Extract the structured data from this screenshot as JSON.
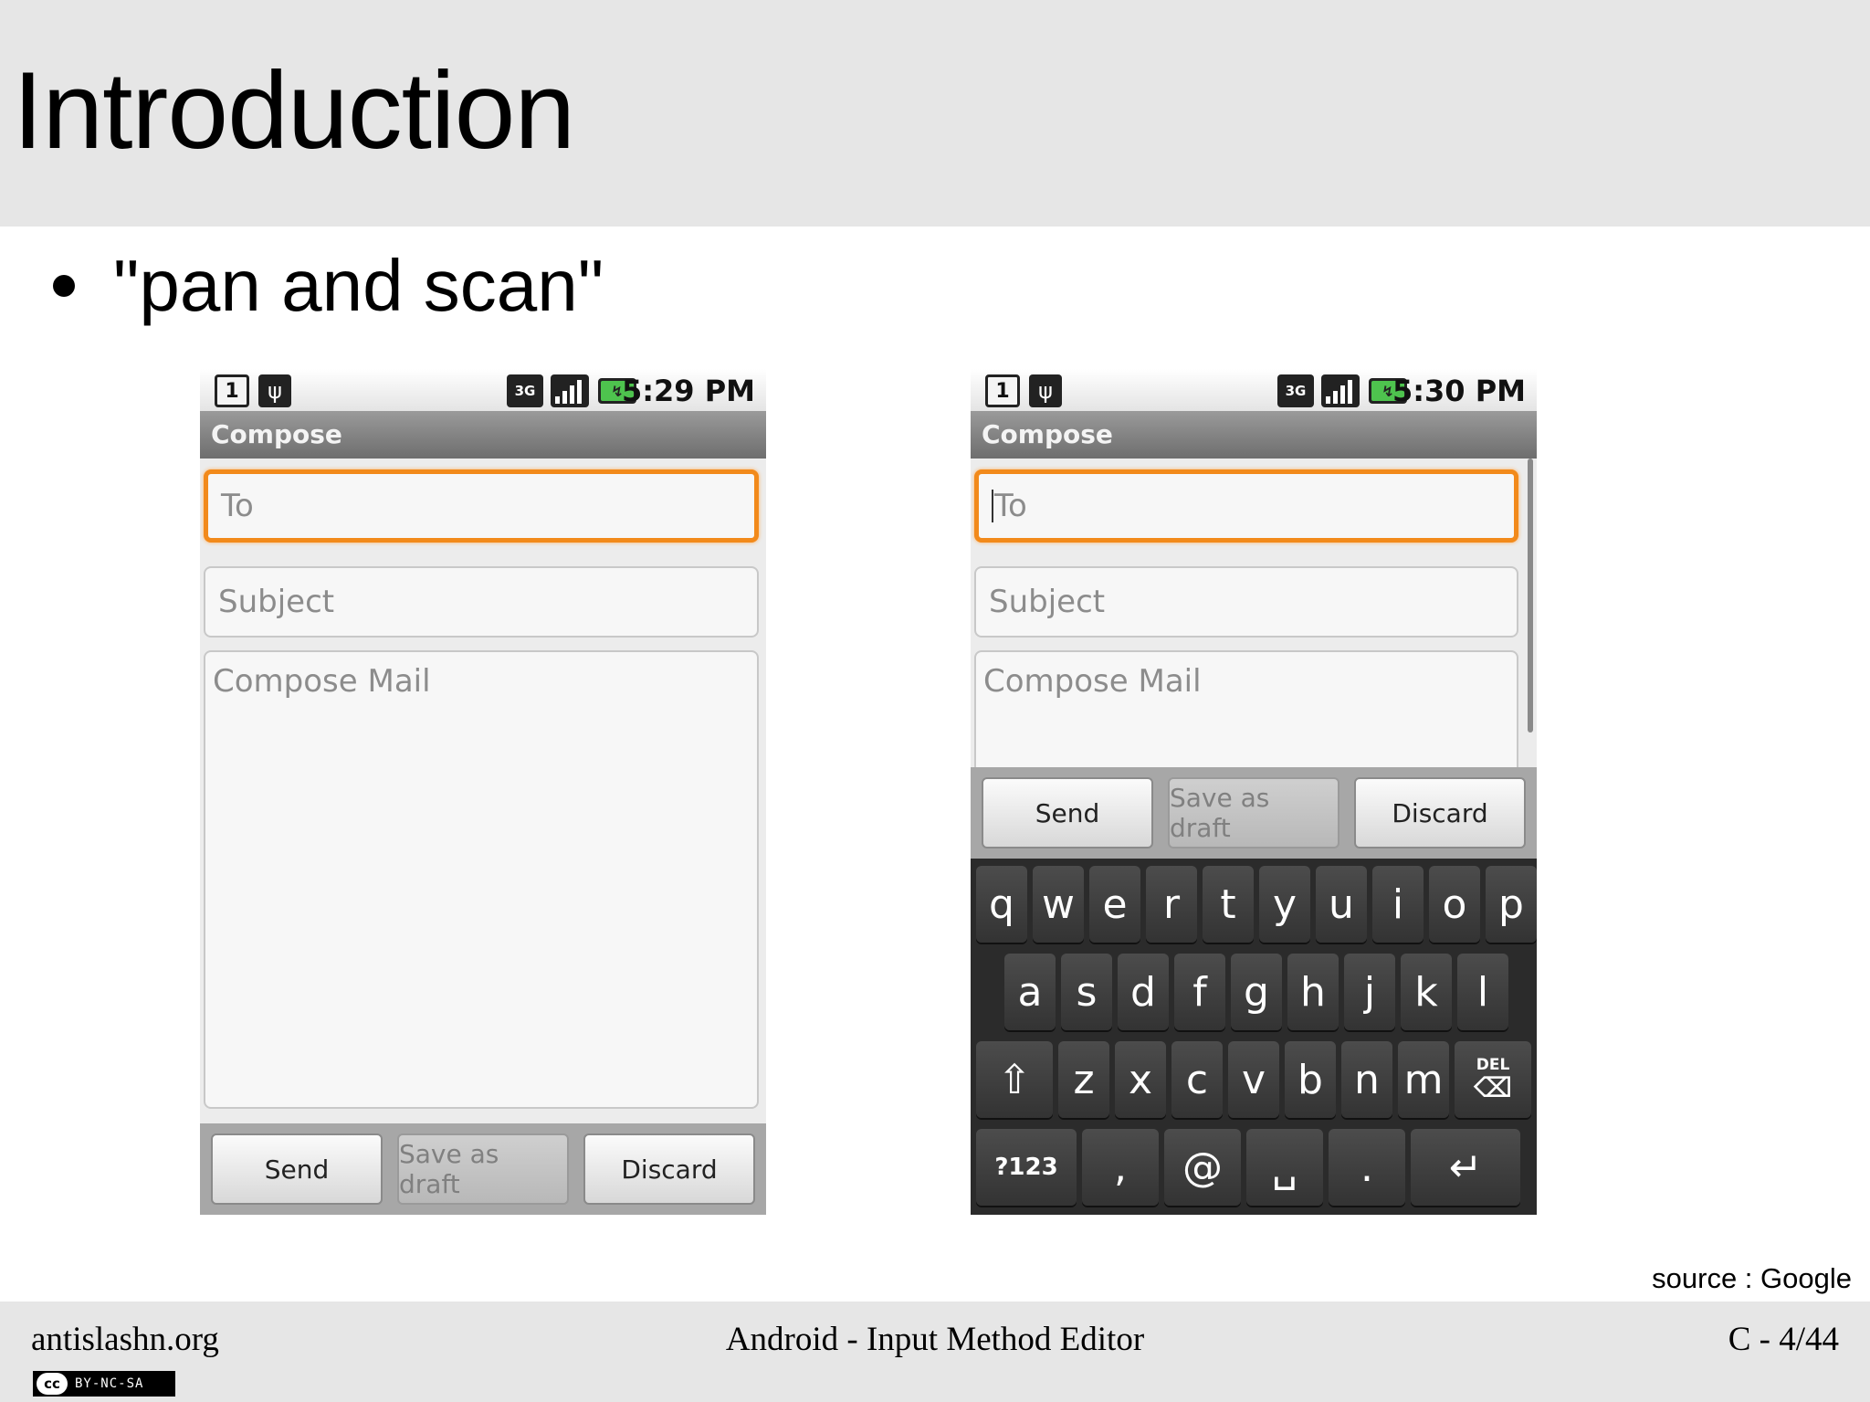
{
  "slide": {
    "title": "Introduction",
    "bullet": "\"pan and scan\"",
    "source": "source : Google"
  },
  "footer": {
    "site": "antislashn.org",
    "subject": "Android - Input Method Editor",
    "page": "C - 4/44",
    "license_symbol": "cc",
    "license_text": "BY-NC-SA"
  },
  "screens": [
    {
      "clock": "5:29 PM",
      "sim_label": "1",
      "network": "3G",
      "title": "Compose",
      "to_placeholder": "To",
      "subject_placeholder": "Subject",
      "body_placeholder": "Compose Mail",
      "buttons": {
        "send": "Send",
        "draft": "Save as draft",
        "discard": "Discard"
      }
    },
    {
      "clock": "5:30 PM",
      "sim_label": "1",
      "network": "3G",
      "title": "Compose",
      "to_placeholder": "To",
      "subject_placeholder": "Subject",
      "body_placeholder": "Compose Mail",
      "buttons": {
        "send": "Send",
        "draft": "Save as draft",
        "discard": "Discard"
      },
      "keyboard": {
        "row1": [
          "q",
          "w",
          "e",
          "r",
          "t",
          "y",
          "u",
          "i",
          "o",
          "p"
        ],
        "row2": [
          "a",
          "s",
          "d",
          "f",
          "g",
          "h",
          "j",
          "k",
          "l"
        ],
        "row3": [
          "z",
          "x",
          "c",
          "v",
          "b",
          "n",
          "m"
        ],
        "del_label": "DEL",
        "symbols_label": "?123",
        "comma": ",",
        "at": "@",
        "period": "."
      }
    }
  ],
  "icons": {
    "usb": "usb-icon",
    "signal": "signal-icon",
    "battery": "battery-charging-icon",
    "shift": "shift-icon",
    "enter": "enter-icon",
    "space": "space-icon"
  },
  "colors": {
    "focus_ring": "#f28a1b",
    "band": "#e6e6e6",
    "keyboard_bg": "#2b2b2b"
  }
}
